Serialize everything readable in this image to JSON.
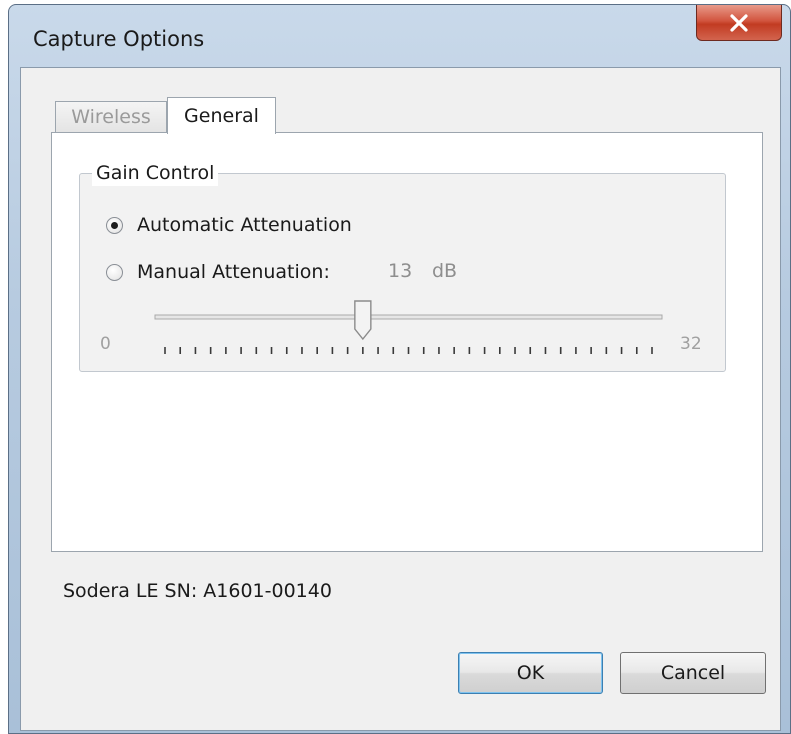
{
  "window": {
    "title": "Capture Options",
    "close_icon": "close-x-icon"
  },
  "tabs": [
    {
      "label": "Wireless",
      "active": false
    },
    {
      "label": "General",
      "active": true
    }
  ],
  "gain_control": {
    "title": "Gain Control",
    "automatic_label": "Automatic Attenuation",
    "automatic_selected": true,
    "manual_label": "Manual Attenuation:",
    "manual_selected": false,
    "value": "13",
    "unit": "dB",
    "slider": {
      "min": 0,
      "max": 32,
      "value": 13,
      "min_label": "0",
      "max_label": "32",
      "tick_count": 33,
      "enabled": false
    }
  },
  "serial": "Sodera LE SN: A1601-00140",
  "buttons": {
    "ok": "OK",
    "cancel": "Cancel"
  },
  "colors": {
    "close_button": "#c7412a",
    "disabled_text": "#8e8e8e",
    "panel_bg": "#f0f0f0"
  }
}
